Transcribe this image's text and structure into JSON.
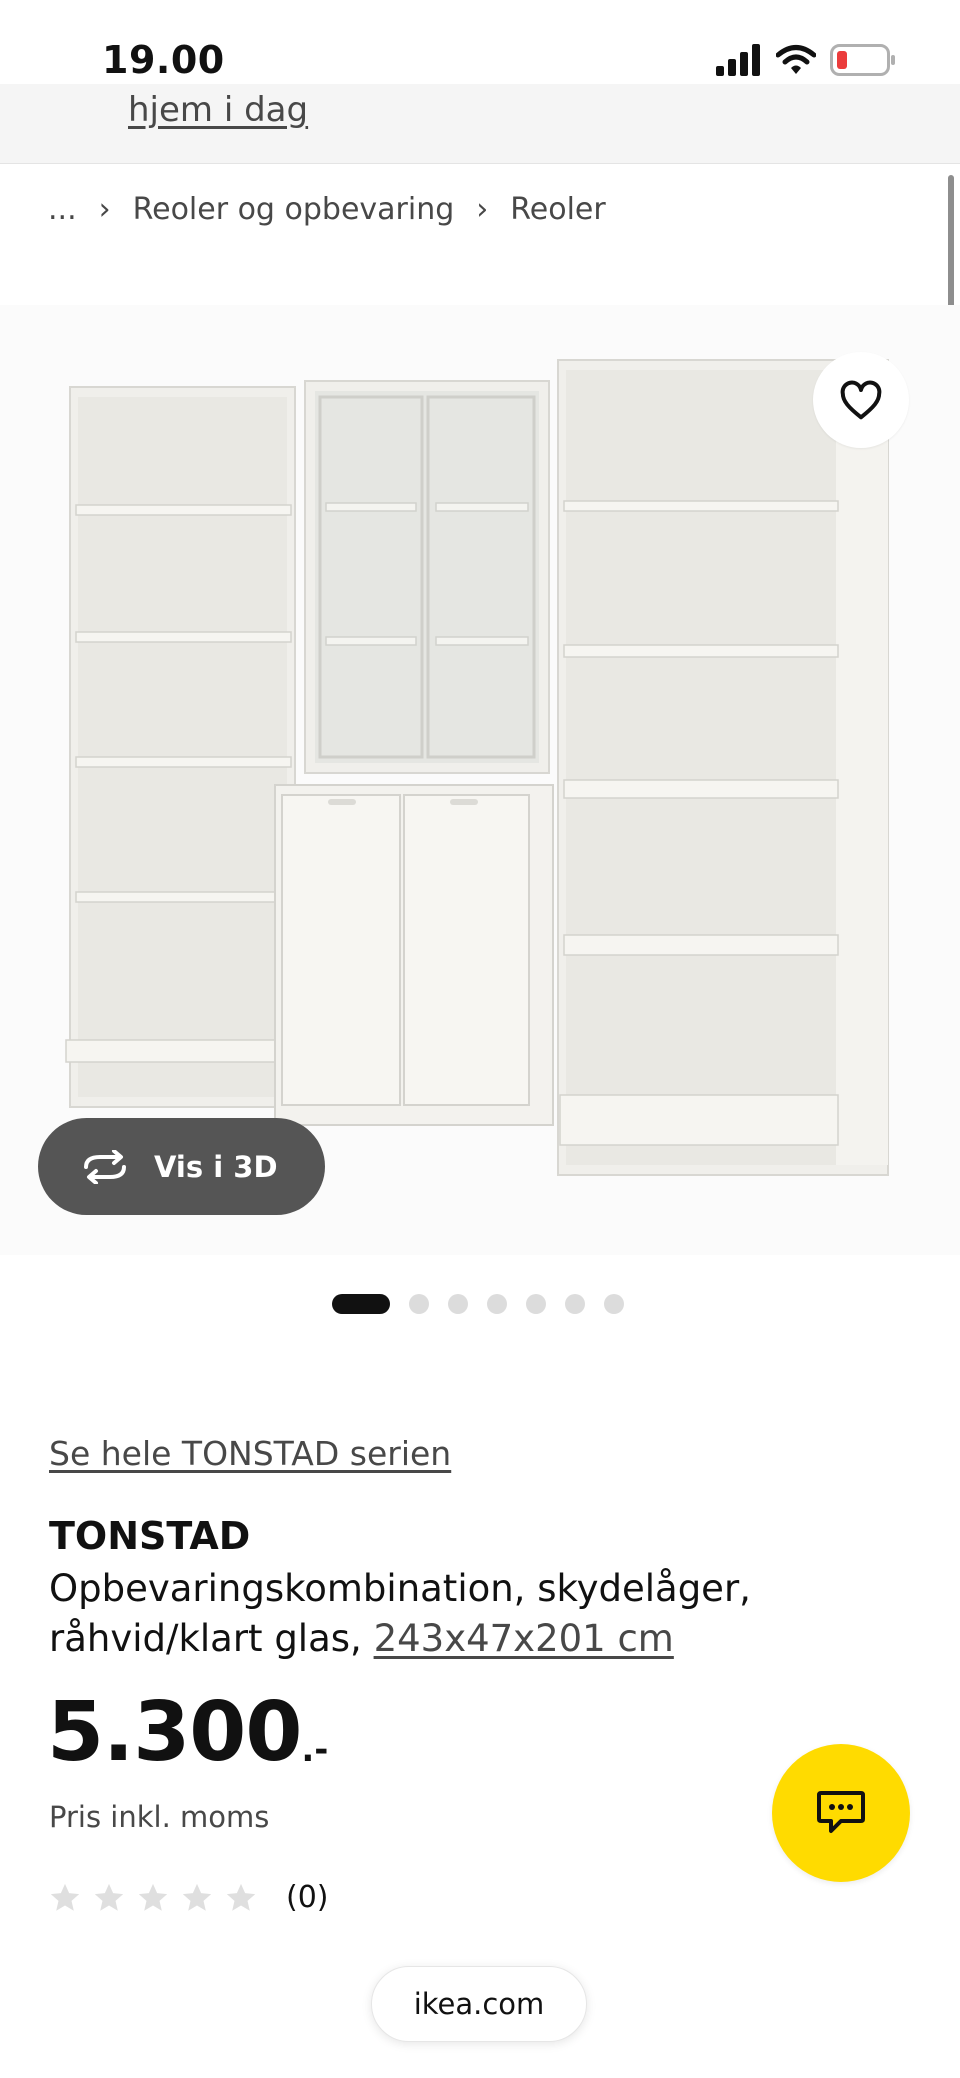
{
  "status_bar": {
    "time": "19.00",
    "icons": [
      "signal-icon",
      "wifi-icon",
      "battery-low-icon"
    ]
  },
  "top_strip": {
    "link": "hjem i dag"
  },
  "breadcrumb": {
    "items": [
      "...",
      "Reoler og opbevaring",
      "Reoler"
    ],
    "separator": "›"
  },
  "gallery": {
    "vis3d_label": "Vis i 3D",
    "image_count": 7,
    "active_index": 0,
    "favorite_icon": "heart-icon"
  },
  "product": {
    "series_link": "Se hele TONSTAD serien",
    "name": "TONSTAD",
    "description": "Opbevaringskombination, skydelåger, råhvid/klart glas,",
    "dimensions": "243x47x201 cm",
    "price_integer": "5.300",
    "price_decimal": ".-",
    "price_note": "Pris inkl. moms",
    "rating_value": 0,
    "rating_max": 5,
    "rating_count": "(0)"
  },
  "chat": {
    "icon": "chat-icon",
    "color": "#ffdb00"
  },
  "browser": {
    "url": "ikea.com"
  }
}
